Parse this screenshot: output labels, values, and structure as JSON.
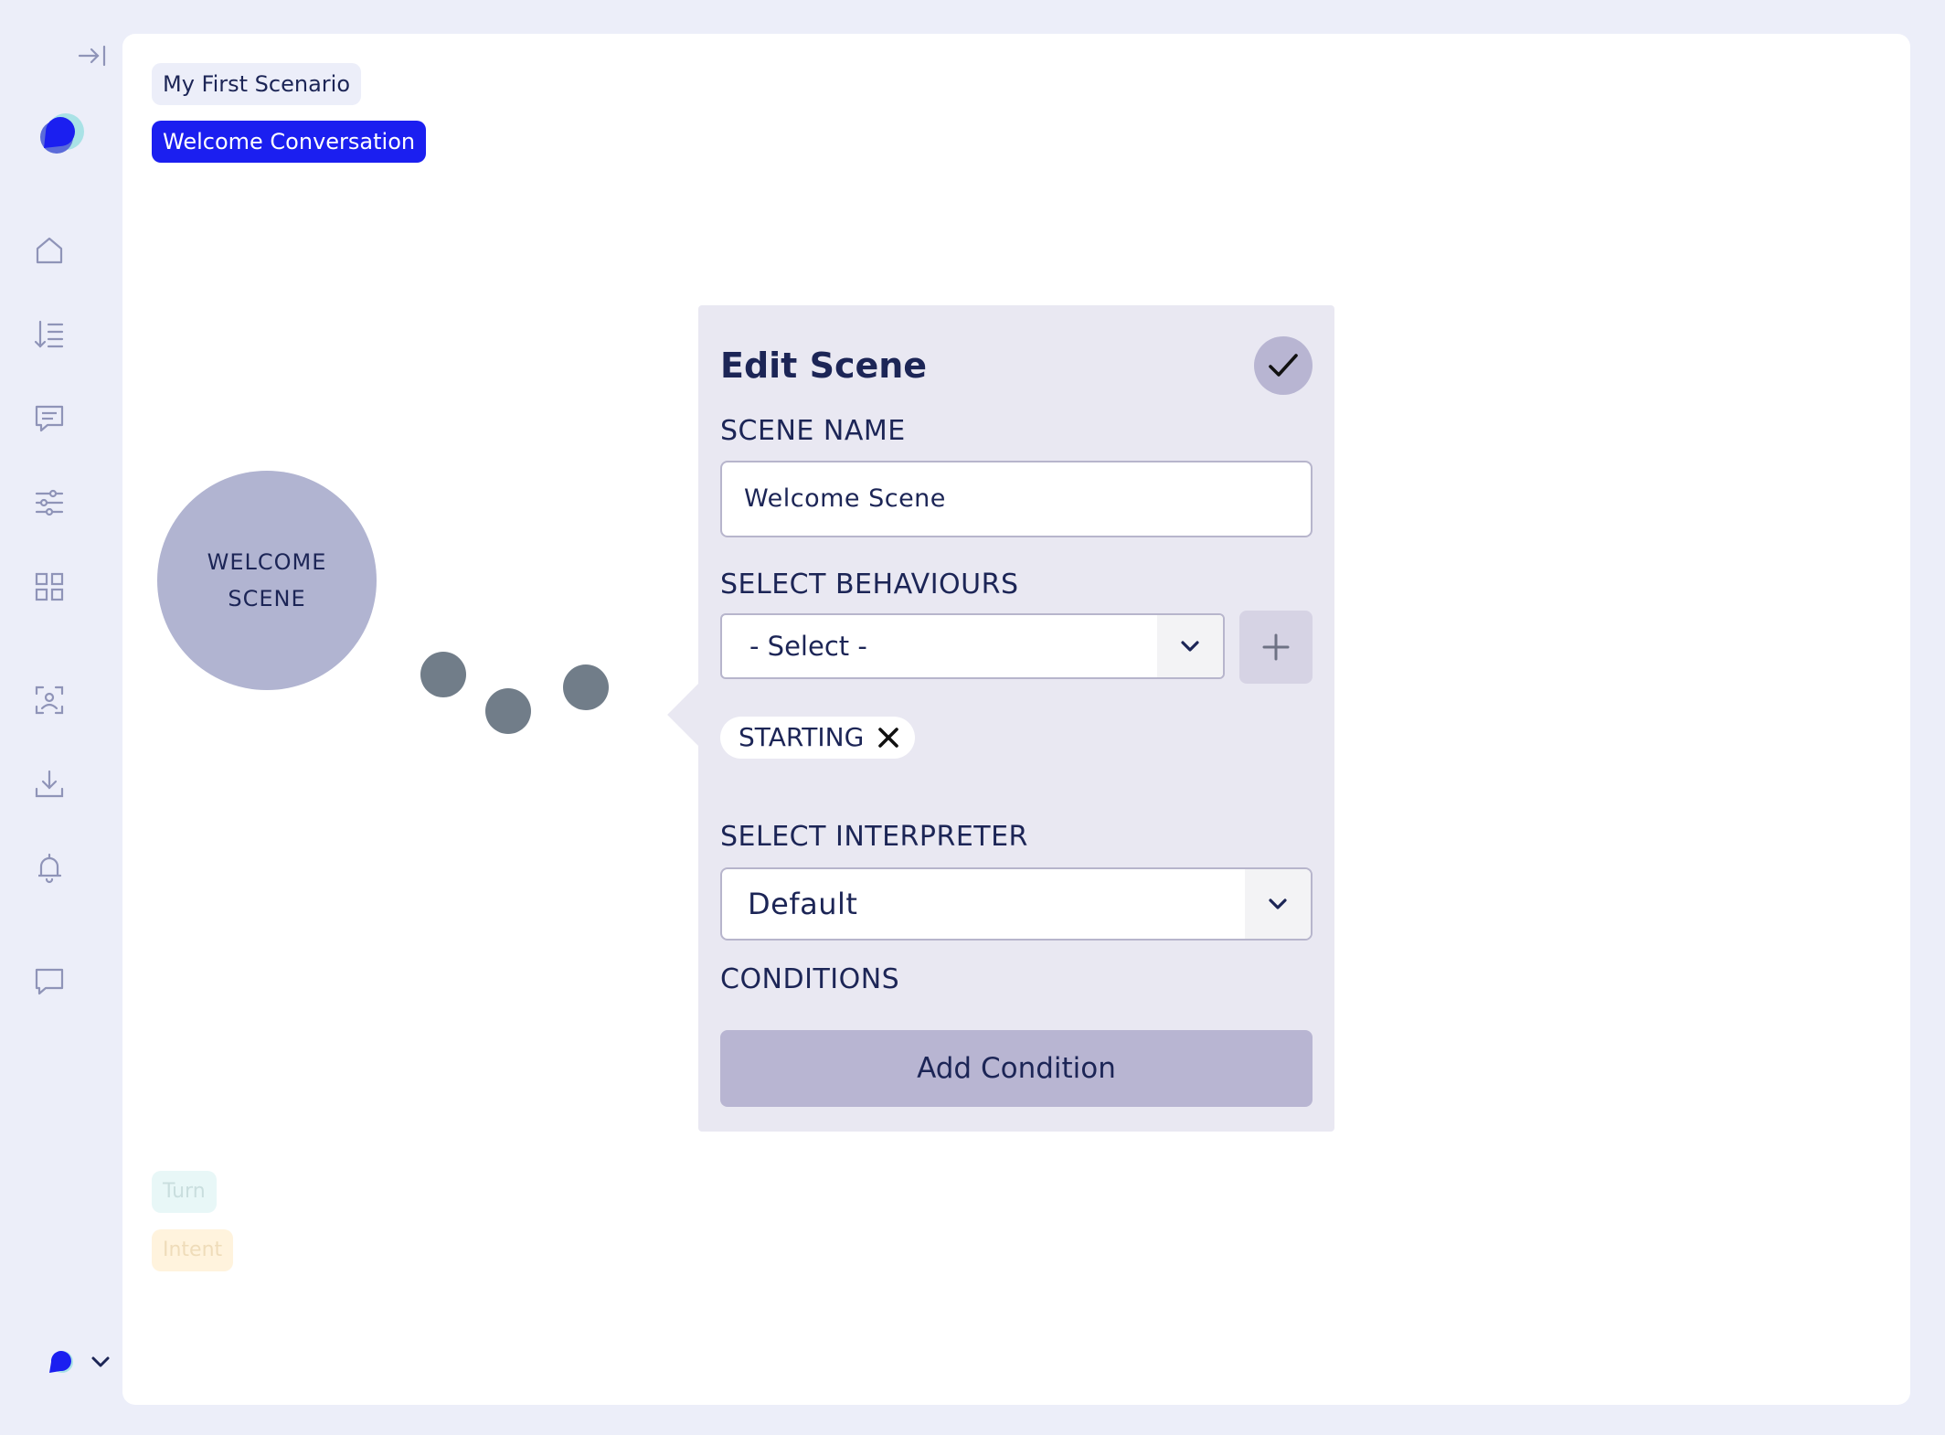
{
  "sidebar": {
    "icons": [
      "collapse-icon",
      "logo-icon",
      "home-icon",
      "sort-list-icon",
      "message-icon",
      "sliders-icon",
      "grid-icon",
      "face-scan-icon",
      "download-icon",
      "bell-icon",
      "chat-icon",
      "workspace-logo-icon",
      "chevron-down-icon"
    ]
  },
  "breadcrumbs": [
    "My First Scenario",
    "Welcome Conversation"
  ],
  "canvas": {
    "scene_node_label": "WELCOME SCENE",
    "legend": {
      "turn": "Turn",
      "intent": "Intent"
    }
  },
  "edit_scene": {
    "title": "Edit Scene",
    "scene_name_label": "SCENE NAME",
    "scene_name_value": "Welcome Scene",
    "behaviours_label": "SELECT BEHAVIOURS",
    "behaviours_select_value": "- Select -",
    "behaviour_chip": "STARTING",
    "interpreter_label": "SELECT INTERPRETER",
    "interpreter_value": "Default",
    "conditions_label": "CONDITIONS",
    "add_condition_label": "Add Condition"
  },
  "colors": {
    "background": "#eceef9",
    "accent_blue": "#1b1ff0",
    "panel": "#e9e8f2",
    "node": "#b1b4d1",
    "button": "#b8b5d2",
    "text": "#1c2556"
  }
}
